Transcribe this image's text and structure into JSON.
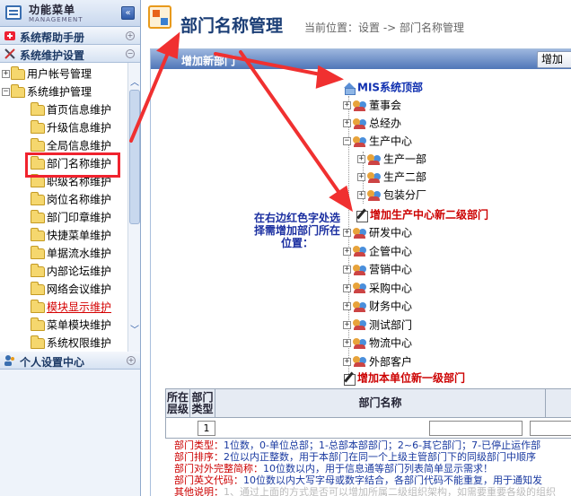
{
  "sidebar": {
    "title": "功能菜单",
    "subtitle": "MANAGEMENT",
    "collapse_label": "«",
    "sections": {
      "help": "系统帮助手册",
      "maintenance": "系统维护设置",
      "personal": "个人设置中心"
    },
    "tree": {
      "user_accounts": "用户帐号管理",
      "system_maintenance": "系统维护管理",
      "items": [
        "首页信息维护",
        "升级信息维护",
        "全局信息维护",
        "部门名称维护",
        "职级名称维护",
        "岗位名称维护",
        "部门印章维护",
        "快捷菜单维护",
        "单据流水维护",
        "内部论坛维护",
        "网络会议维护",
        "模块显示维护",
        "菜单模块维护",
        "系统权限维护"
      ]
    }
  },
  "main": {
    "title": "部门名称管理",
    "breadcrumb": "当前位置：设置 -> 部门名称管理",
    "add_bar_label": "增加新部门",
    "add_button": "增加",
    "hint": "在右边红色字处选择需增加部门所在位置：",
    "tree": {
      "root": "MIS系统顶部",
      "level1_before": [
        "董事会",
        "总经办",
        "生产中心"
      ],
      "children": [
        "生产一部",
        "生产二部",
        "包装分厂"
      ],
      "add_sub": "增加生产中心新二级部门",
      "level1_after": [
        "研发中心",
        "企管中心",
        "营销中心",
        "采购中心",
        "财务中心",
        "测试部门",
        "物流中心",
        "外部客户"
      ],
      "add_top": "增加本单位新一级部门"
    },
    "table": {
      "col_level": "所在层级",
      "col_type": "部门类型",
      "col_name": "部门名称",
      "type_value": "1"
    },
    "notes": [
      {
        "label": "部门类型：",
        "text": "1位数，0-单位总部；1-总部本部部门；2~6-其它部门；7-已停止运作部"
      },
      {
        "label": "部门排序：",
        "text": "2位以内正整数，用于本部门在同一个上级主管部门下的同级部门中顺序"
      },
      {
        "label": "部门对外完整简称：",
        "text": "10位数以内，用于信息通等部门列表简单显示需求！"
      },
      {
        "label": "部门英文代码：",
        "text": "10位数以内大写字母或数字结合，各部门代码不能重复，用于通知发"
      },
      {
        "label": "其他说明：",
        "text": "1、通过上面的方式是否可以增加所属二级组织架构，如需要重要各级的组织"
      }
    ]
  }
}
